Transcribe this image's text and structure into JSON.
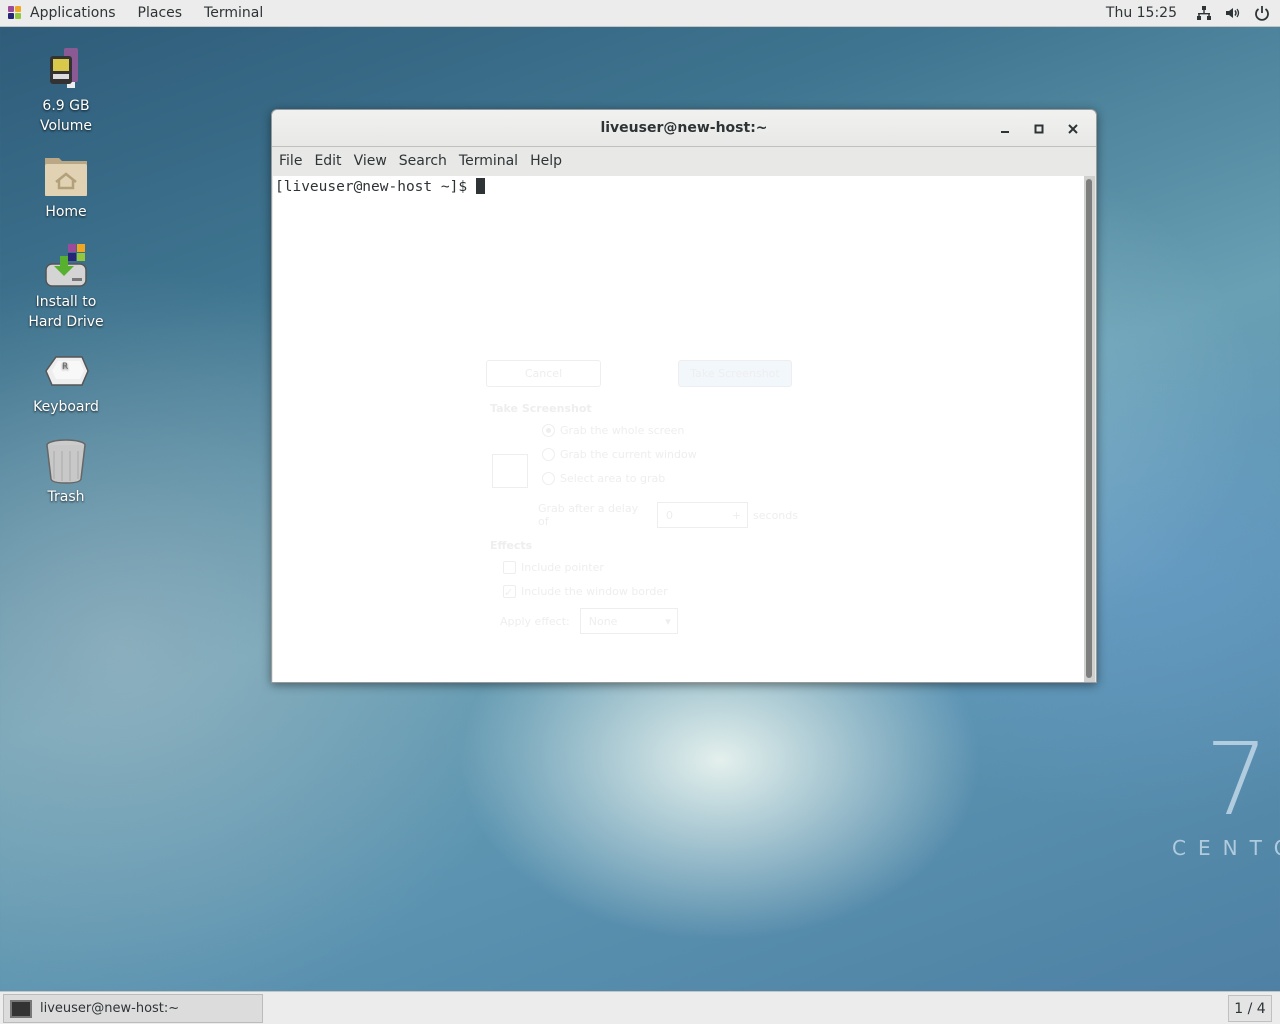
{
  "topbar": {
    "menus": [
      "Applications",
      "Places",
      "Terminal"
    ],
    "clock": "Thu 15:25",
    "tray_icons": [
      "network-icon",
      "volume-icon",
      "power-icon"
    ]
  },
  "desktop": {
    "icons": [
      {
        "label": "6.9 GB\nVolume",
        "icon": "usb-drive-icon"
      },
      {
        "label": "Home",
        "icon": "home-folder-icon"
      },
      {
        "label": "Install to\nHard Drive",
        "icon": "install-drive-icon"
      },
      {
        "label": "Keyboard",
        "icon": "keyboard-icon"
      },
      {
        "label": "Trash",
        "icon": "trash-icon"
      }
    ],
    "branding": {
      "number": "7",
      "text": "CENTO"
    }
  },
  "window": {
    "title": "liveuser@new-host:~",
    "menus": [
      "File",
      "Edit",
      "View",
      "Search",
      "Terminal",
      "Help"
    ],
    "prompt": "[liveuser@new-host ~]$ "
  },
  "screenshot_dialog": {
    "cancel": "Cancel",
    "take": "Take Screenshot",
    "section_title": "Take Screenshot",
    "options": [
      "Grab the whole screen",
      "Grab the current window",
      "Select area to grab"
    ],
    "selected_option": 0,
    "delay_label": "Grab after a delay of",
    "delay_value": "0",
    "delay_unit": "seconds",
    "effects_title": "Effects",
    "include_pointer": "Include pointer",
    "include_pointer_checked": false,
    "include_border": "Include the window border",
    "include_border_checked": true,
    "apply_effect_label": "Apply effect:",
    "apply_effect_value": "None"
  },
  "taskbar": {
    "task_label": "liveuser@new-host:~",
    "workspace": "1 / 4"
  }
}
